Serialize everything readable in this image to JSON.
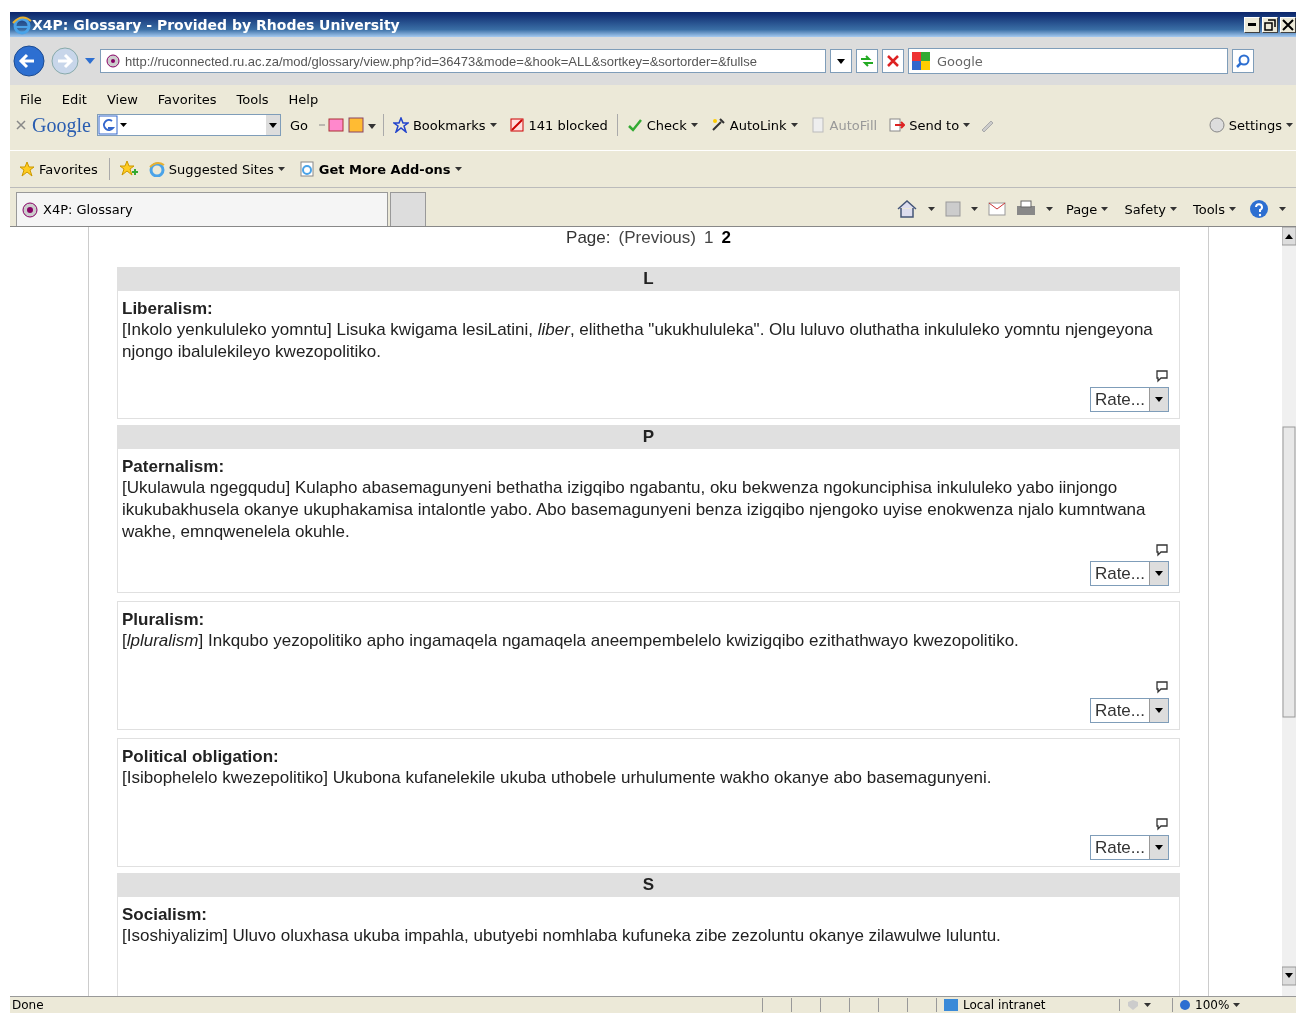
{
  "window": {
    "title": "X4P: Glossary - Provided by Rhodes University"
  },
  "address_bar": {
    "url": "http://ruconnected.ru.ac.za/mod/glossary/view.php?id=36473&mode=&hook=ALL&sortkey=&sortorder=&fullse"
  },
  "search_box": {
    "placeholder": "Google"
  },
  "menu": [
    "File",
    "Edit",
    "View",
    "Favorites",
    "Tools",
    "Help"
  ],
  "google_toolbar": {
    "logo": "Google",
    "items": [
      {
        "label": "Go",
        "disabled": false
      },
      {
        "label": "Bookmarks",
        "disabled": false
      },
      {
        "label": "141 blocked",
        "disabled": false
      },
      {
        "label": "Check",
        "disabled": false
      },
      {
        "label": "AutoLink",
        "disabled": false
      },
      {
        "label": "AutoFill",
        "disabled": true
      },
      {
        "label": "Send to",
        "disabled": false
      }
    ],
    "settings": "Settings"
  },
  "favorites_bar": [
    {
      "label": "Favorites",
      "bold": false
    },
    {
      "label": "Suggested Sites",
      "bold": false
    },
    {
      "label": "Get More Add-ons",
      "bold": true
    }
  ],
  "tabs": [
    {
      "label": "X4P: Glossary",
      "selected": true
    }
  ],
  "command_bar": [
    "Page",
    "Safety",
    "Tools"
  ],
  "pager": {
    "label": "Page:",
    "previous": "(Previous)",
    "pages": [
      {
        "label": "1",
        "selected": false
      },
      {
        "label": "2",
        "selected": true
      }
    ]
  },
  "entries": [
    {
      "letter": "L",
      "term": "Liberalism:",
      "definition": "[Inkolo yenkululeko yomntu] Lisuka kwigama lesiLatini, *liber*, elithetha \"ukukhululeka\". Olu luluvo oluthatha inkululeko yomntu njengeyona njongo ibalulekileyo kwezopolitiko.",
      "rate": "Rate..."
    },
    {
      "letter": "P",
      "term": "Paternalism:",
      "definition": "[Ukulawula ngegqudu] Kulapho abasemagunyeni bethatha izigqibo ngabantu, oku bekwenza ngokunciphisa inkululeko yabo iinjongo ikukubakhusela okanye ukuphakamisa intalontle yabo. Abo basemagunyeni benza izigqibo njengoko uyise enokwenza njalo kumntwana wakhe, emnqwenelela okuhle.",
      "rate": "Rate..."
    },
    {
      "term": "Pluralism:",
      "definition": "[*lpluralism*] Inkqubo yezopolitiko apho ingamaqela ngamaqela aneempembelelo kwizigqibo ezithathwayo kwezopolitiko.",
      "rate": "Rate..."
    },
    {
      "term": "Political obligation:",
      "definition": "[Isibophelelo kwezepolitiko] Ukubona kufanelekile ukuba uthobele urhulumente wakho okanye abo basemagunyeni.",
      "rate": "Rate..."
    },
    {
      "letter": "S",
      "term": "Socialism:",
      "definition": "[Isoshiyalizim] Uluvo oluxhasa ukuba impahla, ubutyebi nomhlaba kufuneka zibe zezoluntu okanye zilawulwe luluntu."
    }
  ],
  "status_bar": {
    "text": "Done",
    "zone": "Local intranet",
    "zoom": "100%"
  }
}
